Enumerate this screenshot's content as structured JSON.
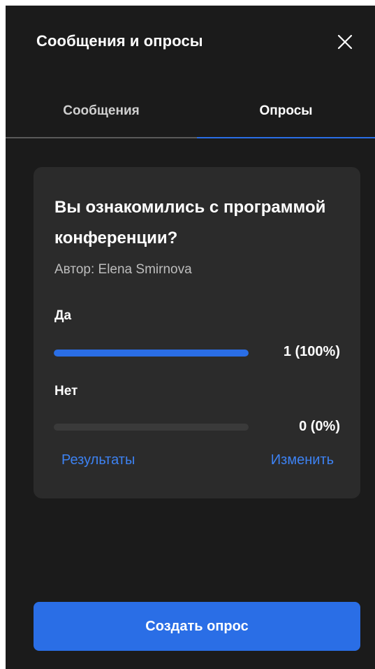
{
  "header": {
    "title": "Сообщения и опросы",
    "close_icon": "close-icon"
  },
  "tabs": [
    {
      "label": "Сообщения",
      "active": false
    },
    {
      "label": "Опросы",
      "active": true
    }
  ],
  "poll": {
    "question": "Вы ознакомились с программой конференции?",
    "author": "Автор: Elena Smirnova",
    "options": [
      {
        "label": "Да",
        "value": "1 (100%)",
        "fraction": 1.0
      },
      {
        "label": "Нет",
        "value": "0 (0%)",
        "fraction": 0.0
      }
    ],
    "results_label": "Результаты",
    "edit_label": "Изменить"
  },
  "create_button": {
    "label": "Создать опрос"
  },
  "colors": {
    "accent": "#2a6ee6",
    "panel_bg": "#1b1b1b",
    "card_bg": "#2b2b2b",
    "link": "#3d82f2"
  }
}
